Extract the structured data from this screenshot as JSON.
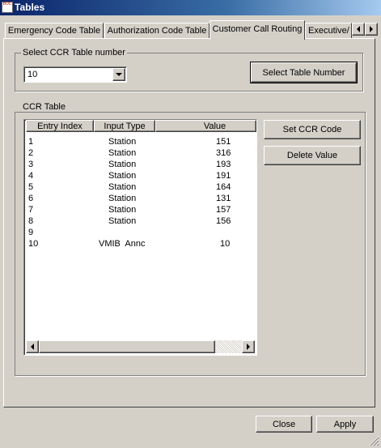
{
  "window": {
    "title": "Tables",
    "icon_text": "BOC"
  },
  "tabs": [
    {
      "label": "Emergency Code Table"
    },
    {
      "label": "Authorization Code Table"
    },
    {
      "label": "Customer Call Routing"
    },
    {
      "label": "Executive/"
    }
  ],
  "select_group": {
    "label": "Select CCR Table number",
    "combo_value": "10",
    "select_button": "Select Table Number"
  },
  "ccr_group": {
    "label": "CCR Table",
    "columns": [
      "Entry Index",
      "Input Type",
      "Value"
    ],
    "rows": [
      {
        "index": "1",
        "type": "Station",
        "value": "151"
      },
      {
        "index": "2",
        "type": "Station",
        "value": "316"
      },
      {
        "index": "3",
        "type": "Station",
        "value": "193"
      },
      {
        "index": "4",
        "type": "Station",
        "value": "191"
      },
      {
        "index": "5",
        "type": "Station",
        "value": "164"
      },
      {
        "index": "6",
        "type": "Station",
        "value": "131"
      },
      {
        "index": "7",
        "type": "Station",
        "value": "157"
      },
      {
        "index": "8",
        "type": "Station",
        "value": "156"
      },
      {
        "index": "9",
        "type": "",
        "value": ""
      },
      {
        "index": "10",
        "type": "VMIB  Annc",
        "value": "10"
      }
    ],
    "set_ccr_button": "Set CCR Code",
    "delete_button": "Delete Value"
  },
  "footer": {
    "close": "Close",
    "apply": "Apply"
  }
}
